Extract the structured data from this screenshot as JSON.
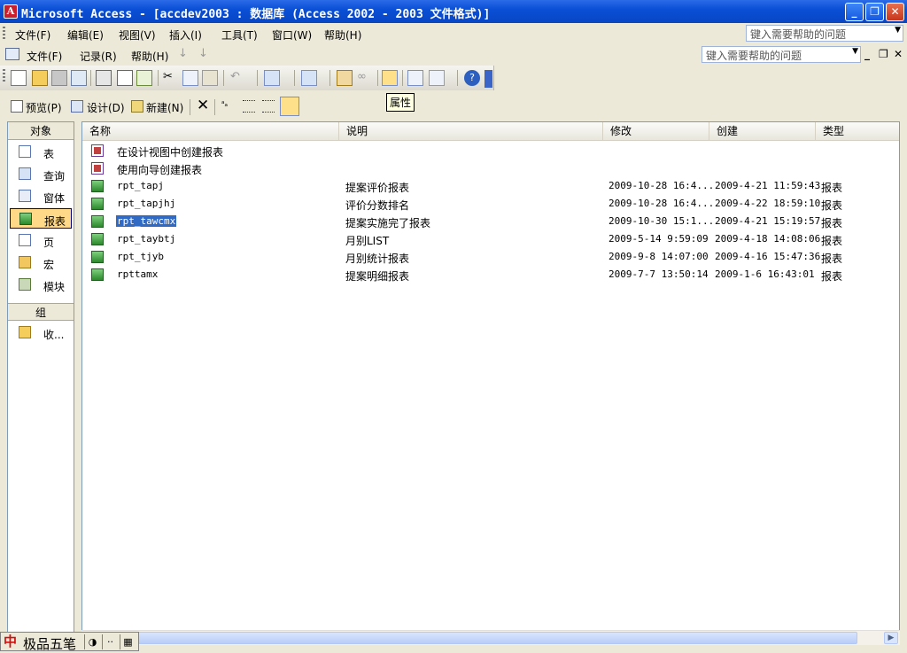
{
  "window": {
    "title": "Microsoft Access - [accdev2003 : 数据库 (Access 2002 - 2003 文件格式)]"
  },
  "menu_app": {
    "items": [
      "文件(F)",
      "编辑(E)",
      "视图(V)",
      "插入(I)",
      "工具(T)",
      "窗口(W)",
      "帮助(H)"
    ],
    "help_placeholder": "键入需要帮助的问题"
  },
  "menu_doc": {
    "items": [
      "文件(F)",
      "记录(R)",
      "帮助(H)"
    ],
    "help_placeholder": "键入需要帮助的问题"
  },
  "toolbar": {
    "tooltip": "属性"
  },
  "db_toolbar": {
    "preview": "预览(P)",
    "design": "设计(D)",
    "new": "新建(N)"
  },
  "objects": {
    "header": "对象",
    "items": [
      {
        "label": "表",
        "icon": "table-icon"
      },
      {
        "label": "查询",
        "icon": "query-icon"
      },
      {
        "label": "窗体",
        "icon": "form-icon"
      },
      {
        "label": "报表",
        "icon": "report-icon",
        "active": true
      },
      {
        "label": "页",
        "icon": "page-icon"
      },
      {
        "label": "宏",
        "icon": "macro-icon"
      },
      {
        "label": "模块",
        "icon": "module-icon"
      }
    ],
    "groups_header": "组",
    "groups": [
      {
        "label": "收...",
        "icon": "favorites-icon"
      }
    ]
  },
  "list": {
    "columns": [
      "名称",
      "说明",
      "修改",
      "创建",
      "类型"
    ],
    "shortcuts": [
      "在设计视图中创建报表",
      "使用向导创建报表"
    ],
    "rows": [
      {
        "name": "rpt_tapj",
        "desc": "提案评价报表",
        "modified": "2009-10-28 16:4...",
        "created": "2009-4-21 11:59:43",
        "type": "报表"
      },
      {
        "name": "rpt_tapjhj",
        "desc": "评价分数排名",
        "modified": "2009-10-28 16:4...",
        "created": "2009-4-22 18:59:10",
        "type": "报表"
      },
      {
        "name": "rpt_tawcmx",
        "desc": "提案实施完了报表",
        "modified": "2009-10-30 15:1...",
        "created": "2009-4-21 15:19:57",
        "type": "报表",
        "selected": true
      },
      {
        "name": "rpt_taybtj",
        "desc": "月别LIST",
        "modified": "2009-5-14 9:59:09",
        "created": "2009-4-18 14:08:06",
        "type": "报表"
      },
      {
        "name": "rpt_tjyb",
        "desc": "月别统计报表",
        "modified": "2009-9-8 14:07:00",
        "created": "2009-4-16 15:47:36",
        "type": "报表"
      },
      {
        "name": "rpttamx",
        "desc": "提案明细报表",
        "modified": "2009-7-7 13:50:14",
        "created": "2009-1-6 16:43:01",
        "type": "报表"
      }
    ]
  },
  "ime": {
    "logo": "中",
    "name": "极品五笔"
  }
}
